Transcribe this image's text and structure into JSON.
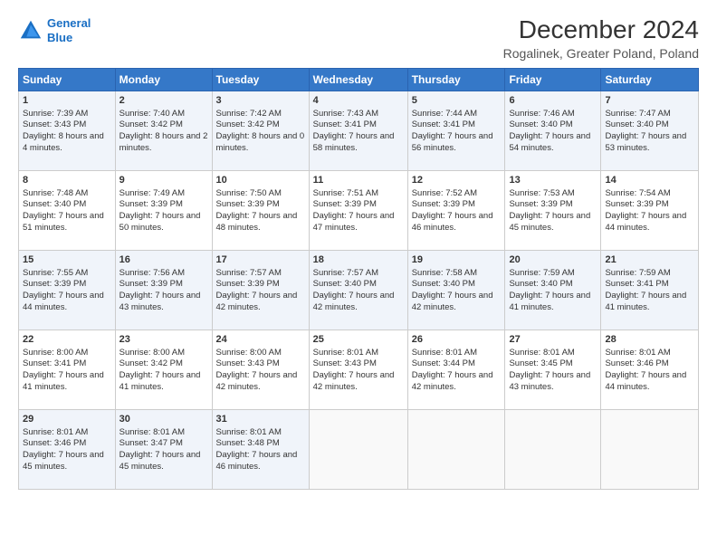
{
  "logo": {
    "line1": "General",
    "line2": "Blue"
  },
  "title": "December 2024",
  "subtitle": "Rogalinek, Greater Poland, Poland",
  "header_days": [
    "Sunday",
    "Monday",
    "Tuesday",
    "Wednesday",
    "Thursday",
    "Friday",
    "Saturday"
  ],
  "weeks": [
    [
      {
        "day": "1",
        "sunrise": "Sunrise: 7:39 AM",
        "sunset": "Sunset: 3:43 PM",
        "daylight": "Daylight: 8 hours and 4 minutes."
      },
      {
        "day": "2",
        "sunrise": "Sunrise: 7:40 AM",
        "sunset": "Sunset: 3:42 PM",
        "daylight": "Daylight: 8 hours and 2 minutes."
      },
      {
        "day": "3",
        "sunrise": "Sunrise: 7:42 AM",
        "sunset": "Sunset: 3:42 PM",
        "daylight": "Daylight: 8 hours and 0 minutes."
      },
      {
        "day": "4",
        "sunrise": "Sunrise: 7:43 AM",
        "sunset": "Sunset: 3:41 PM",
        "daylight": "Daylight: 7 hours and 58 minutes."
      },
      {
        "day": "5",
        "sunrise": "Sunrise: 7:44 AM",
        "sunset": "Sunset: 3:41 PM",
        "daylight": "Daylight: 7 hours and 56 minutes."
      },
      {
        "day": "6",
        "sunrise": "Sunrise: 7:46 AM",
        "sunset": "Sunset: 3:40 PM",
        "daylight": "Daylight: 7 hours and 54 minutes."
      },
      {
        "day": "7",
        "sunrise": "Sunrise: 7:47 AM",
        "sunset": "Sunset: 3:40 PM",
        "daylight": "Daylight: 7 hours and 53 minutes."
      }
    ],
    [
      {
        "day": "8",
        "sunrise": "Sunrise: 7:48 AM",
        "sunset": "Sunset: 3:40 PM",
        "daylight": "Daylight: 7 hours and 51 minutes."
      },
      {
        "day": "9",
        "sunrise": "Sunrise: 7:49 AM",
        "sunset": "Sunset: 3:39 PM",
        "daylight": "Daylight: 7 hours and 50 minutes."
      },
      {
        "day": "10",
        "sunrise": "Sunrise: 7:50 AM",
        "sunset": "Sunset: 3:39 PM",
        "daylight": "Daylight: 7 hours and 48 minutes."
      },
      {
        "day": "11",
        "sunrise": "Sunrise: 7:51 AM",
        "sunset": "Sunset: 3:39 PM",
        "daylight": "Daylight: 7 hours and 47 minutes."
      },
      {
        "day": "12",
        "sunrise": "Sunrise: 7:52 AM",
        "sunset": "Sunset: 3:39 PM",
        "daylight": "Daylight: 7 hours and 46 minutes."
      },
      {
        "day": "13",
        "sunrise": "Sunrise: 7:53 AM",
        "sunset": "Sunset: 3:39 PM",
        "daylight": "Daylight: 7 hours and 45 minutes."
      },
      {
        "day": "14",
        "sunrise": "Sunrise: 7:54 AM",
        "sunset": "Sunset: 3:39 PM",
        "daylight": "Daylight: 7 hours and 44 minutes."
      }
    ],
    [
      {
        "day": "15",
        "sunrise": "Sunrise: 7:55 AM",
        "sunset": "Sunset: 3:39 PM",
        "daylight": "Daylight: 7 hours and 44 minutes."
      },
      {
        "day": "16",
        "sunrise": "Sunrise: 7:56 AM",
        "sunset": "Sunset: 3:39 PM",
        "daylight": "Daylight: 7 hours and 43 minutes."
      },
      {
        "day": "17",
        "sunrise": "Sunrise: 7:57 AM",
        "sunset": "Sunset: 3:39 PM",
        "daylight": "Daylight: 7 hours and 42 minutes."
      },
      {
        "day": "18",
        "sunrise": "Sunrise: 7:57 AM",
        "sunset": "Sunset: 3:40 PM",
        "daylight": "Daylight: 7 hours and 42 minutes."
      },
      {
        "day": "19",
        "sunrise": "Sunrise: 7:58 AM",
        "sunset": "Sunset: 3:40 PM",
        "daylight": "Daylight: 7 hours and 42 minutes."
      },
      {
        "day": "20",
        "sunrise": "Sunrise: 7:59 AM",
        "sunset": "Sunset: 3:40 PM",
        "daylight": "Daylight: 7 hours and 41 minutes."
      },
      {
        "day": "21",
        "sunrise": "Sunrise: 7:59 AM",
        "sunset": "Sunset: 3:41 PM",
        "daylight": "Daylight: 7 hours and 41 minutes."
      }
    ],
    [
      {
        "day": "22",
        "sunrise": "Sunrise: 8:00 AM",
        "sunset": "Sunset: 3:41 PM",
        "daylight": "Daylight: 7 hours and 41 minutes."
      },
      {
        "day": "23",
        "sunrise": "Sunrise: 8:00 AM",
        "sunset": "Sunset: 3:42 PM",
        "daylight": "Daylight: 7 hours and 41 minutes."
      },
      {
        "day": "24",
        "sunrise": "Sunrise: 8:00 AM",
        "sunset": "Sunset: 3:43 PM",
        "daylight": "Daylight: 7 hours and 42 minutes."
      },
      {
        "day": "25",
        "sunrise": "Sunrise: 8:01 AM",
        "sunset": "Sunset: 3:43 PM",
        "daylight": "Daylight: 7 hours and 42 minutes."
      },
      {
        "day": "26",
        "sunrise": "Sunrise: 8:01 AM",
        "sunset": "Sunset: 3:44 PM",
        "daylight": "Daylight: 7 hours and 42 minutes."
      },
      {
        "day": "27",
        "sunrise": "Sunrise: 8:01 AM",
        "sunset": "Sunset: 3:45 PM",
        "daylight": "Daylight: 7 hours and 43 minutes."
      },
      {
        "day": "28",
        "sunrise": "Sunrise: 8:01 AM",
        "sunset": "Sunset: 3:46 PM",
        "daylight": "Daylight: 7 hours and 44 minutes."
      }
    ],
    [
      {
        "day": "29",
        "sunrise": "Sunrise: 8:01 AM",
        "sunset": "Sunset: 3:46 PM",
        "daylight": "Daylight: 7 hours and 45 minutes."
      },
      {
        "day": "30",
        "sunrise": "Sunrise: 8:01 AM",
        "sunset": "Sunset: 3:47 PM",
        "daylight": "Daylight: 7 hours and 45 minutes."
      },
      {
        "day": "31",
        "sunrise": "Sunrise: 8:01 AM",
        "sunset": "Sunset: 3:48 PM",
        "daylight": "Daylight: 7 hours and 46 minutes."
      },
      null,
      null,
      null,
      null
    ]
  ]
}
